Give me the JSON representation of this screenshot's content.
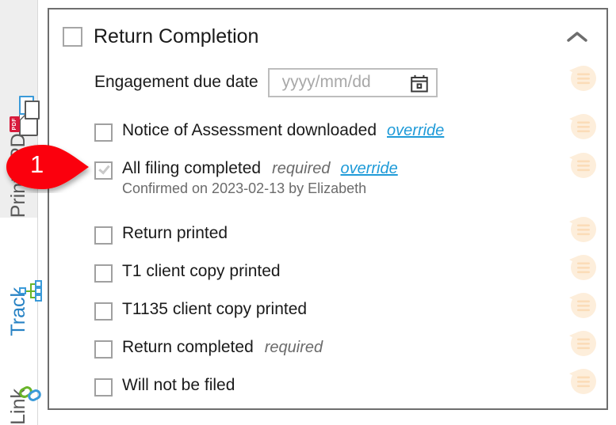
{
  "sidebar": {
    "items": [
      {
        "id": "print-pdf",
        "label": "Print / PDF",
        "icon": "pdf-document-icon",
        "active": false,
        "shaded": true
      },
      {
        "id": "track",
        "label": "Track",
        "icon": "hierarchy-track-icon",
        "active": true,
        "shaded": false
      },
      {
        "id": "link",
        "label": "Link",
        "icon": "chain-link-icon",
        "active": false,
        "shaded": false
      }
    ]
  },
  "callout": {
    "number": "1",
    "color": "#fb0007"
  },
  "panel": {
    "title": "Return Completion",
    "collapse_icon": "chevron-up-icon",
    "header_checked": false,
    "due_date": {
      "label": "Engagement due date",
      "value": "",
      "placeholder": "yyyy/mm/dd",
      "calendar_icon": "calendar-icon"
    },
    "items": [
      {
        "label": "Notice of Assessment downloaded",
        "checked": false,
        "required": "",
        "override": "override",
        "sub": "",
        "note": true
      },
      {
        "label": "All filing completed",
        "checked": true,
        "required": "required",
        "override": "override",
        "sub": "Confirmed on 2023-02-13 by Elizabeth",
        "note": true
      },
      {
        "label": "Return printed",
        "checked": false,
        "required": "",
        "override": "",
        "sub": "",
        "note": true
      },
      {
        "label": "T1 client copy printed",
        "checked": false,
        "required": "",
        "override": "",
        "sub": "",
        "note": true
      },
      {
        "label": "T1135 client copy printed",
        "checked": false,
        "required": "",
        "override": "",
        "sub": "",
        "note": true
      },
      {
        "label": "Return completed",
        "checked": false,
        "required": "required",
        "override": "",
        "sub": "",
        "note": true
      },
      {
        "label": "Will not be filed",
        "checked": false,
        "required": "",
        "override": "",
        "sub": "",
        "note": true
      }
    ],
    "extra_notes": 1
  },
  "colors": {
    "accent_blue": "#1f9bd8",
    "track_blue": "#2782c4",
    "note_bubble": "#fdf0dc",
    "callout_red": "#fb0007",
    "panel_border": "#6e6e6e"
  }
}
